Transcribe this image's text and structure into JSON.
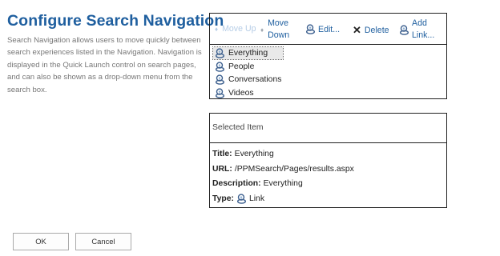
{
  "page": {
    "title": "Configure Search Navigation",
    "description": "Search Navigation allows users to move quickly between search experiences listed in the Navigation. Navigation is displayed in the Quick Launch control on search pages, and can also be shown as a drop-down menu from the search box."
  },
  "toolbar": {
    "move_up": "Move Up",
    "move_down_line1": "Move",
    "move_down_line2": "Down",
    "edit": "Edit...",
    "delete": "Delete",
    "add_link_line1": "Add",
    "add_link_line2": "Link..."
  },
  "nav_items": [
    {
      "label": "Everything",
      "selected": true
    },
    {
      "label": "People",
      "selected": false
    },
    {
      "label": "Conversations",
      "selected": false
    },
    {
      "label": "Videos",
      "selected": false
    }
  ],
  "selected_item": {
    "header": "Selected Item",
    "title_label": "Title:",
    "title_value": "Everything",
    "url_label": "URL:",
    "url_value": "/PPMSearch/Pages/results.aspx",
    "description_label": "Description:",
    "description_value": "Everything",
    "type_label": "Type:",
    "type_value": "Link"
  },
  "buttons": {
    "ok": "OK",
    "cancel": "Cancel"
  },
  "colors": {
    "title": "#1f5f9f",
    "link": "#1f5f9f",
    "disabled": "#b6cde6"
  },
  "icons": {
    "link": "link-icon",
    "delete": "close-icon",
    "move_up": "arrow-up-icon",
    "move_down": "arrow-down-icon"
  }
}
